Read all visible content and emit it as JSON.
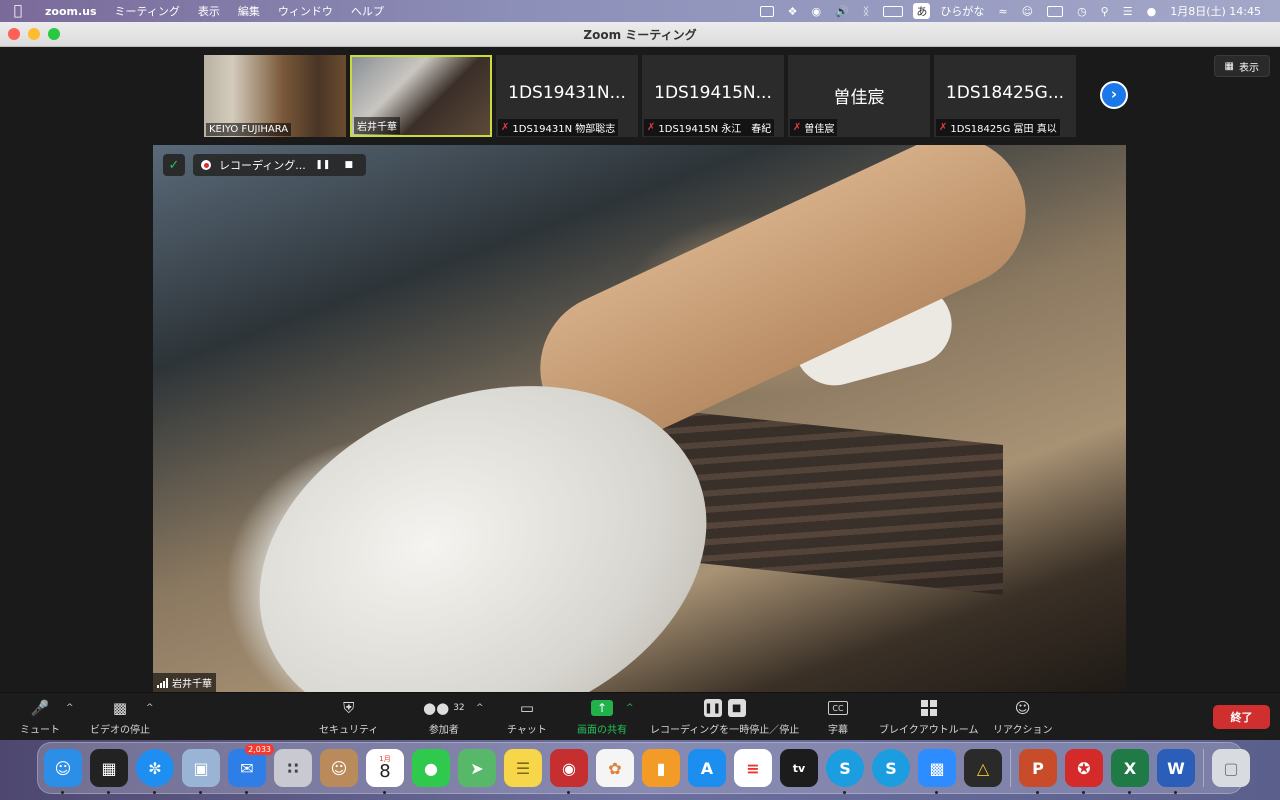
{
  "menubar": {
    "app": "zoom.us",
    "items": [
      "ミーティング",
      "表示",
      "編集",
      "ウィンドウ",
      "ヘルプ"
    ],
    "input_mode": "ひらがな",
    "input_icon": "あ",
    "datetime": "1月8日(土)  14:45"
  },
  "window": {
    "title": "Zoom ミーティング"
  },
  "gallery": {
    "view_button": "表示",
    "tiles": [
      {
        "name": "KEIYO FUJIHARA",
        "big": "",
        "muted": false,
        "video": true
      },
      {
        "name": "岩井千華",
        "big": "",
        "muted": false,
        "video": true,
        "active": true
      },
      {
        "name": "1DS19431N 物部聡志",
        "big": "1DS19431N...",
        "muted": true,
        "video": false
      },
      {
        "name": "1DS19415N 永江　春紀",
        "big": "1DS19415N...",
        "muted": true,
        "video": false
      },
      {
        "name": "曽佳宸",
        "big": "曽佳宸",
        "muted": true,
        "video": false
      },
      {
        "name": "1DS18425G 冨田 真以",
        "big": "1DS18425G...",
        "muted": true,
        "video": false
      }
    ]
  },
  "main": {
    "recording_label": "レコーディング...",
    "speaker_name": "岩井千華"
  },
  "toolbar": {
    "mute": "ミュート",
    "video": "ビデオの停止",
    "security": "セキュリティ",
    "participants": "参加者",
    "participants_count": "32",
    "chat": "チャット",
    "share": "画面の共有",
    "recording": "レコーディングを一時停止／停止",
    "captions": "字幕",
    "captions_icon": "CC",
    "breakout": "ブレイクアウトルーム",
    "reactions": "リアクション",
    "end": "終了"
  },
  "dock": {
    "mail_badge": "2,033",
    "calendar_month": "1月",
    "calendar_day": "8",
    "tv_label": "tv",
    "apps": [
      {
        "name": "finder",
        "color": "#2b8fe8"
      },
      {
        "name": "mission-control",
        "color": "#222"
      },
      {
        "name": "safari",
        "color": "#1e8ff0"
      },
      {
        "name": "preview",
        "color": "#9ab4d6"
      },
      {
        "name": "mail",
        "color": "#2f7ee8"
      },
      {
        "name": "launchpad",
        "color": "#c9c9d2"
      },
      {
        "name": "contacts",
        "color": "#b98b5a"
      },
      {
        "name": "calendar",
        "color": "#ffffff"
      },
      {
        "name": "messages",
        "color": "#2fc94d"
      },
      {
        "name": "maps",
        "color": "#58b86a"
      },
      {
        "name": "notes",
        "color": "#f7d64a"
      },
      {
        "name": "photo-booth",
        "color": "#c62f2f"
      },
      {
        "name": "photos",
        "color": "#f5f5f5"
      },
      {
        "name": "books",
        "color": "#f29b26"
      },
      {
        "name": "app-store",
        "color": "#1c8ef0"
      },
      {
        "name": "reminders",
        "color": "#ffffff"
      },
      {
        "name": "apple-tv",
        "color": "#1c1c1c"
      },
      {
        "name": "skype-1",
        "color": "#1b9de0"
      },
      {
        "name": "skype-2",
        "color": "#1b9de0"
      },
      {
        "name": "zoom",
        "color": "#2d8cff"
      },
      {
        "name": "drive",
        "color": "#2a2a2a"
      },
      {
        "name": "powerpoint",
        "color": "#c94c2a"
      },
      {
        "name": "trend-micro",
        "color": "#d52a2a"
      },
      {
        "name": "excel",
        "color": "#1f7a45"
      },
      {
        "name": "word",
        "color": "#2b5eb8"
      },
      {
        "name": "trash",
        "color": "#d8dbe0"
      }
    ]
  }
}
